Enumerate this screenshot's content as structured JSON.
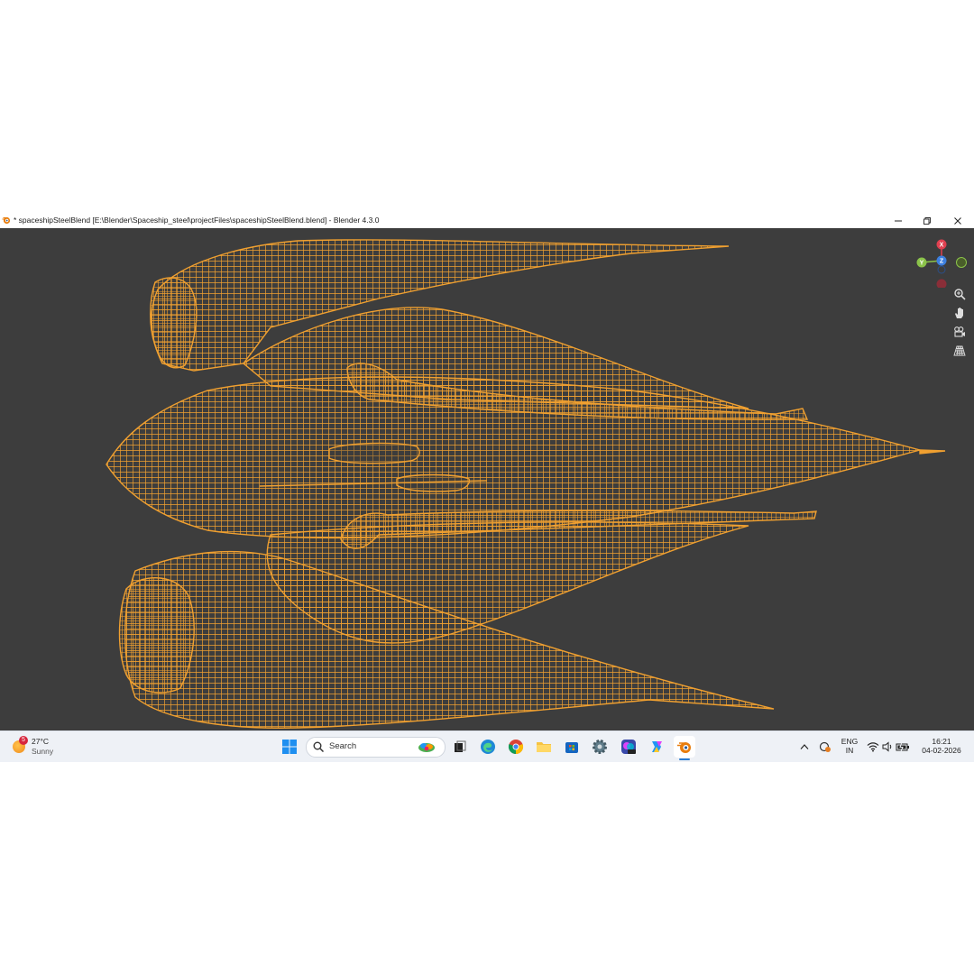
{
  "window": {
    "title": "* spaceshipSteelBlend [E:\\Blender\\Spaceship_steel\\projectFiles\\spaceshipSteelBlend.blend] - Blender 4.3.0",
    "controls": [
      "minimize",
      "restore",
      "close"
    ]
  },
  "viewport": {
    "background": "#3d3d3d",
    "wire_color": "#f0a030",
    "gizmo": {
      "x_label": "X",
      "y_label": "Y",
      "z_label": "Z"
    },
    "nav_icons": [
      "zoom-icon",
      "hand-pan-icon",
      "camera-view-icon",
      "grid-perspective-icon"
    ]
  },
  "taskbar": {
    "weather": {
      "badge": "5",
      "temp": "27°C",
      "condition": "Sunny"
    },
    "search": {
      "label": "Search"
    },
    "apps": [
      "start",
      "task-view",
      "edge",
      "chrome",
      "file-explorer",
      "store",
      "settings",
      "app",
      "copilot",
      "blender"
    ],
    "tray": {
      "lang_line1": "ENG",
      "lang_line2": "IN",
      "time": "16:21",
      "date": "04-02-2026"
    }
  }
}
